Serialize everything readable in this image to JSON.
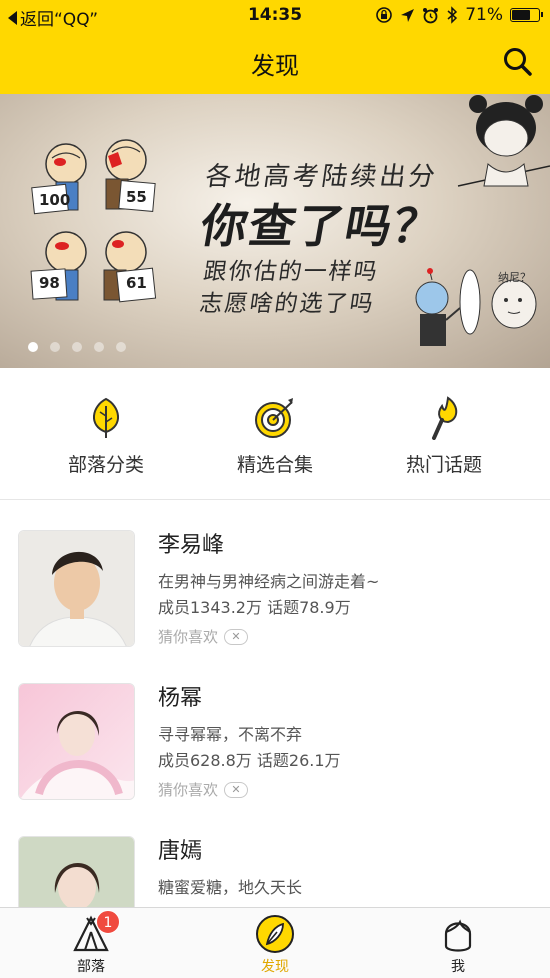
{
  "status_bar": {
    "back_label": "返回“QQ”",
    "time": "14:35",
    "battery": "71%",
    "battery_level": 0.71,
    "icons": [
      "rotation-lock-icon",
      "location-arrow-icon",
      "alarm-icon",
      "bluetooth-icon",
      "battery-icon"
    ]
  },
  "nav": {
    "title": "发现",
    "search_icon": "search-icon"
  },
  "banner": {
    "line1": "各地高考陆续出分",
    "line2": "你查了吗？",
    "line3": "跟你估的一样吗",
    "line4": "志愿啥的选了吗",
    "caption": "纳尼？",
    "scores": [
      "100",
      "55",
      "98",
      "61"
    ],
    "slide_count": 5,
    "active_slide": 1
  },
  "categories": [
    {
      "label": "部落分类",
      "icon": "leaf-icon"
    },
    {
      "label": "精选合集",
      "icon": "target-icon"
    },
    {
      "label": "热门话题",
      "icon": "torch-icon"
    }
  ],
  "list": [
    {
      "title": "李易峰",
      "desc": "在男神与男神经病之间游走着~",
      "stats": "成员1343.2万  话题78.9万",
      "tag": "猜你喜欢"
    },
    {
      "title": "杨幂",
      "desc": "寻寻幂幂，不离不弃",
      "stats": "成员628.8万  话题26.1万",
      "tag": "猜你喜欢"
    },
    {
      "title": "唐嫣",
      "desc": "糖蜜爱糖，地久天长",
      "stats": "",
      "tag": ""
    }
  ],
  "tabbar": {
    "tabs": [
      {
        "label": "部落",
        "icon": "tent-icon",
        "badge": "1"
      },
      {
        "label": "发现",
        "icon": "feather-icon",
        "active": true
      },
      {
        "label": "我",
        "icon": "profile-face-icon"
      }
    ]
  },
  "colors": {
    "brand_yellow": "#ffd800",
    "active_tab": "#e0a800",
    "badge_red": "#f04a3f"
  }
}
